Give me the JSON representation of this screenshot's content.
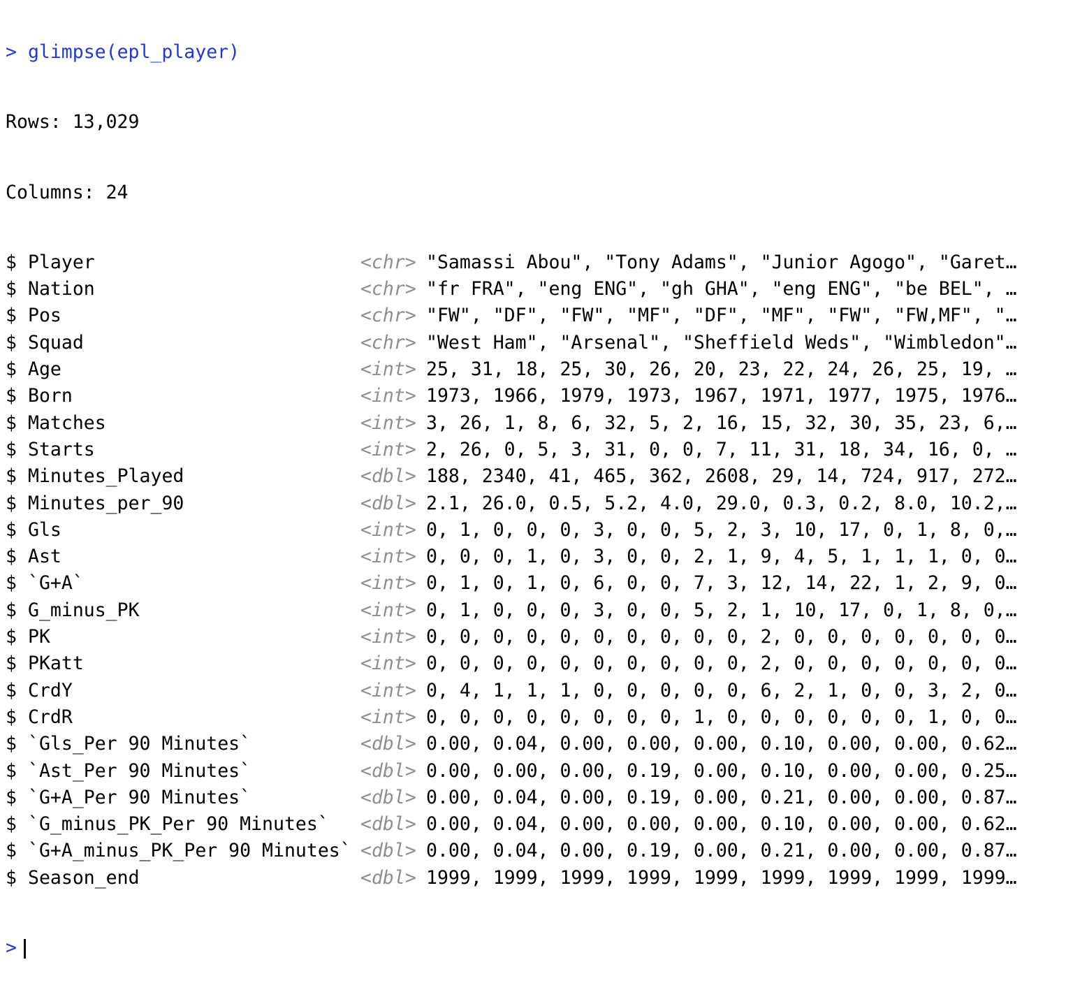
{
  "console": {
    "prompt": ">",
    "command": "glimpse(epl_player)",
    "rows_line": "Rows: 13,029",
    "columns_line": "Columns: 24",
    "field_prefix": "$",
    "fields": [
      {
        "name": "Player",
        "type": "<chr>",
        "values": "\"Samassi Abou\", \"Tony Adams\", \"Junior Agogo\", \"Garet…"
      },
      {
        "name": "Nation",
        "type": "<chr>",
        "values": "\"fr FRA\", \"eng ENG\", \"gh GHA\", \"eng ENG\", \"be BEL\", …"
      },
      {
        "name": "Pos",
        "type": "<chr>",
        "values": "\"FW\", \"DF\", \"FW\", \"MF\", \"DF\", \"MF\", \"FW\", \"FW,MF\", \"…"
      },
      {
        "name": "Squad",
        "type": "<chr>",
        "values": "\"West Ham\", \"Arsenal\", \"Sheffield Weds\", \"Wimbledon\"…"
      },
      {
        "name": "Age",
        "type": "<int>",
        "values": "25, 31, 18, 25, 30, 26, 20, 23, 22, 24, 26, 25, 19, …"
      },
      {
        "name": "Born",
        "type": "<int>",
        "values": "1973, 1966, 1979, 1973, 1967, 1971, 1977, 1975, 1976…"
      },
      {
        "name": "Matches",
        "type": "<int>",
        "values": "3, 26, 1, 8, 6, 32, 5, 2, 16, 15, 32, 30, 35, 23, 6,…"
      },
      {
        "name": "Starts",
        "type": "<int>",
        "values": "2, 26, 0, 5, 3, 31, 0, 0, 7, 11, 31, 18, 34, 16, 0, …"
      },
      {
        "name": "Minutes_Played",
        "type": "<dbl>",
        "values": "188, 2340, 41, 465, 362, 2608, 29, 14, 724, 917, 272…"
      },
      {
        "name": "Minutes_per_90",
        "type": "<dbl>",
        "values": "2.1, 26.0, 0.5, 5.2, 4.0, 29.0, 0.3, 0.2, 8.0, 10.2,…"
      },
      {
        "name": "Gls",
        "type": "<int>",
        "values": "0, 1, 0, 0, 0, 3, 0, 0, 5, 2, 3, 10, 17, 0, 1, 8, 0,…"
      },
      {
        "name": "Ast",
        "type": "<int>",
        "values": "0, 0, 0, 1, 0, 3, 0, 0, 2, 1, 9, 4, 5, 1, 1, 1, 0, 0…"
      },
      {
        "name": "`G+A`",
        "type": "<int>",
        "values": "0, 1, 0, 1, 0, 6, 0, 0, 7, 3, 12, 14, 22, 1, 2, 9, 0…"
      },
      {
        "name": "G_minus_PK",
        "type": "<int>",
        "values": "0, 1, 0, 0, 0, 3, 0, 0, 5, 2, 1, 10, 17, 0, 1, 8, 0,…"
      },
      {
        "name": "PK",
        "type": "<int>",
        "values": "0, 0, 0, 0, 0, 0, 0, 0, 0, 0, 2, 0, 0, 0, 0, 0, 0, 0…"
      },
      {
        "name": "PKatt",
        "type": "<int>",
        "values": "0, 0, 0, 0, 0, 0, 0, 0, 0, 0, 2, 0, 0, 0, 0, 0, 0, 0…"
      },
      {
        "name": "CrdY",
        "type": "<int>",
        "values": "0, 4, 1, 1, 1, 0, 0, 0, 0, 0, 6, 2, 1, 0, 0, 3, 2, 0…"
      },
      {
        "name": "CrdR",
        "type": "<int>",
        "values": "0, 0, 0, 0, 0, 0, 0, 0, 1, 0, 0, 0, 0, 0, 0, 1, 0, 0…"
      },
      {
        "name": "`Gls_Per 90 Minutes`",
        "type": "<dbl>",
        "values": "0.00, 0.04, 0.00, 0.00, 0.00, 0.10, 0.00, 0.00, 0.62…"
      },
      {
        "name": "`Ast_Per 90 Minutes`",
        "type": "<dbl>",
        "values": "0.00, 0.00, 0.00, 0.19, 0.00, 0.10, 0.00, 0.00, 0.25…"
      },
      {
        "name": "`G+A_Per 90 Minutes`",
        "type": "<dbl>",
        "values": "0.00, 0.04, 0.00, 0.19, 0.00, 0.21, 0.00, 0.00, 0.87…"
      },
      {
        "name": "`G_minus_PK_Per 90 Minutes`",
        "type": "<dbl>",
        "values": "0.00, 0.04, 0.00, 0.00, 0.00, 0.10, 0.00, 0.00, 0.62…"
      },
      {
        "name": "`G+A_minus_PK_Per 90 Minutes`",
        "type": "<dbl>",
        "values": "0.00, 0.04, 0.00, 0.19, 0.00, 0.21, 0.00, 0.00, 0.87…"
      },
      {
        "name": "Season_end",
        "type": "<dbl>",
        "values": "1999, 1999, 1999, 1999, 1999, 1999, 1999, 1999, 1999…"
      }
    ]
  },
  "colors": {
    "prompt_and_command": "#1f3ad8",
    "type_tag": "#8e8e8e",
    "text": "#000000",
    "background": "#ffffff"
  }
}
